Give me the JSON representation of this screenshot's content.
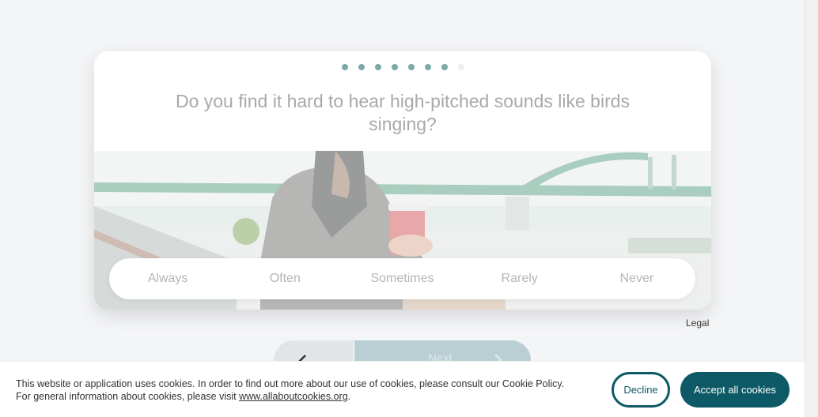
{
  "quiz": {
    "progress": {
      "total_steps": 8,
      "completed_steps": 7
    },
    "question": "Do you find it hard to hear high-pitched sounds like birds singing?",
    "answers": [
      "Always",
      "Often",
      "Sometimes",
      "Rarely",
      "Never"
    ],
    "image_description_icon": "photo-man-with-coffee-cup"
  },
  "footer": {
    "legal_label": "Legal"
  },
  "navigation": {
    "back_icon": "chevron-left-icon",
    "next_label": "Next",
    "next_icon": "chevron-right-icon"
  },
  "cookie_banner": {
    "text_before_link": "This website or application uses cookies. In order to find out more about our use of cookies, please consult our Cookie Policy. For general information about cookies, please visit ",
    "link_text": "www.allaboutcookies.org",
    "text_after_link": ".",
    "decline_label": "Decline",
    "accept_label": "Accept all cookies"
  },
  "colors": {
    "accent": "#0d5a66",
    "dot_active": "#7fa6ad",
    "dot_inactive": "#eceeef",
    "page_background": "#f4f5f7"
  }
}
